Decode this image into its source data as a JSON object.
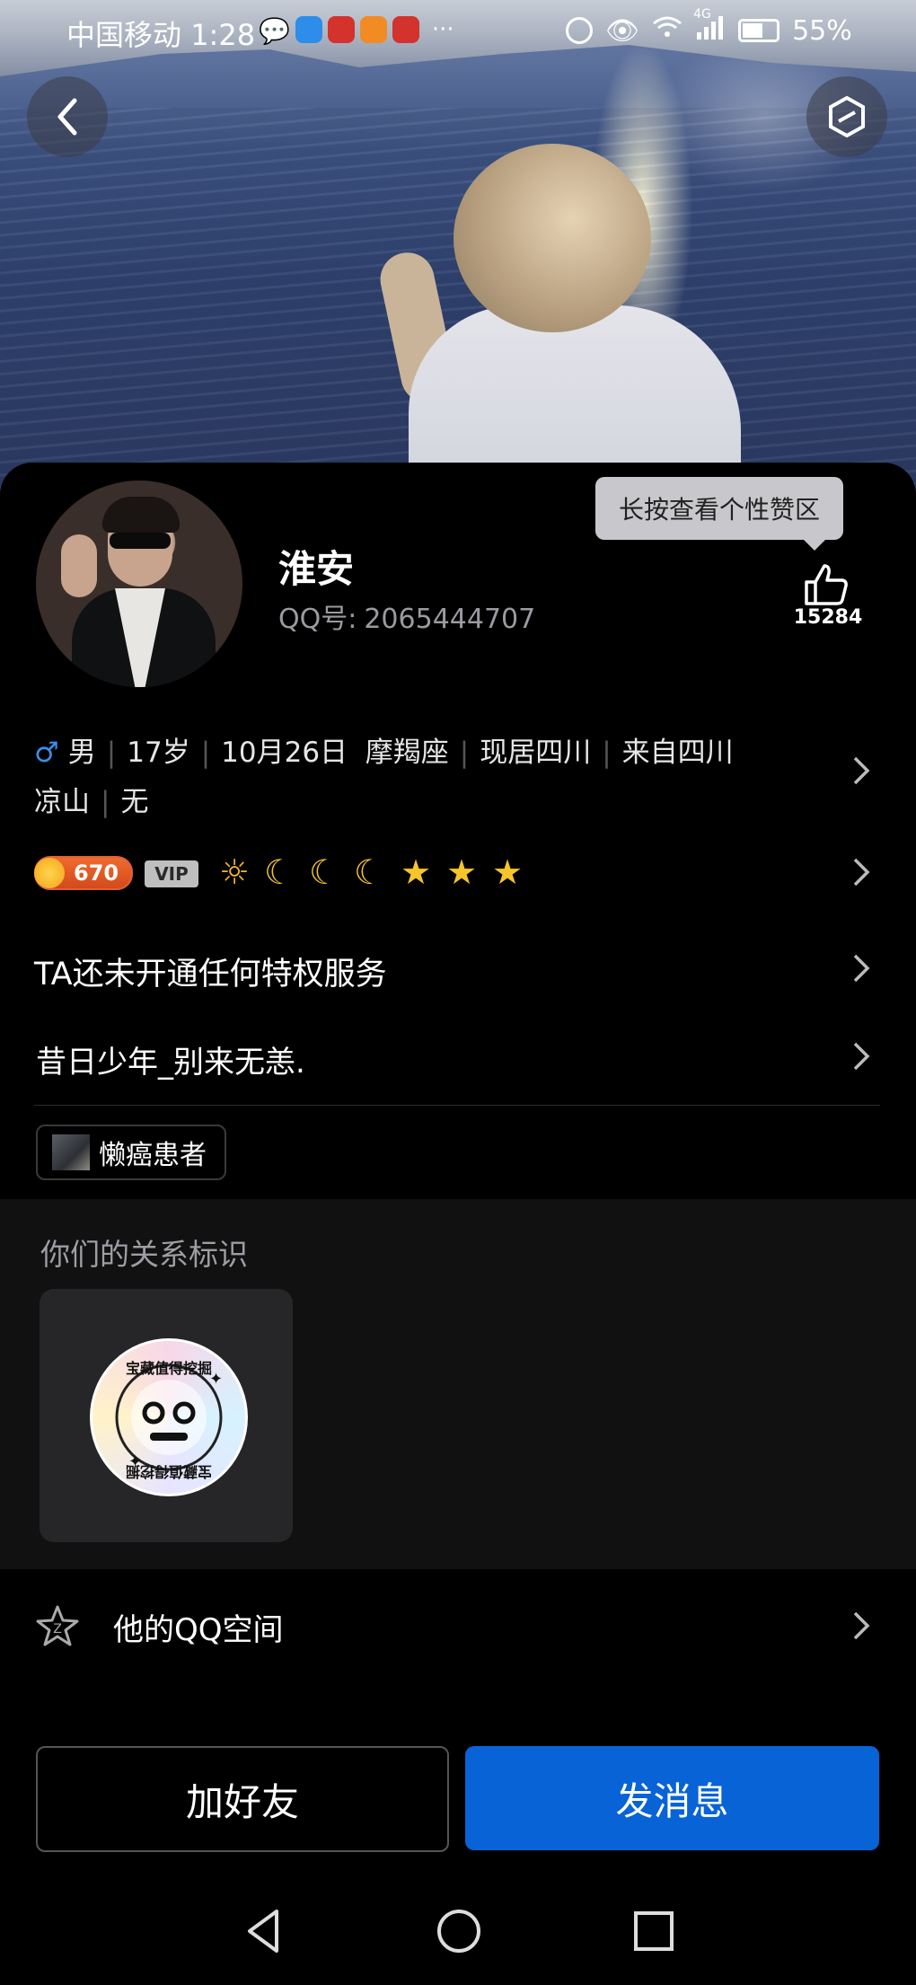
{
  "status_bar": {
    "carrier": "中国移动",
    "time": "1:28",
    "more": "···",
    "network": "4G",
    "battery": "55%"
  },
  "profile": {
    "nickname": "淮安",
    "qq_label": "QQ号:",
    "qq_number": "2065444707",
    "like_tooltip": "长按查看个性赞区",
    "like_count": "15284",
    "gender_icon": "♂",
    "info_line1": [
      "男",
      "17岁",
      "10月26日  摩羯座",
      "现居四川",
      "来自四川"
    ],
    "info_line2": [
      "凉山",
      "无"
    ],
    "level_number": "670",
    "vip_label": "VIP",
    "level_icons": [
      "sun",
      "moon",
      "moon",
      "moon",
      "star",
      "star",
      "star"
    ],
    "privilege_text": "TA还未开通任何特权服务",
    "signature": "昔日少年_别来无恙.",
    "tag_label": "懒癌患者"
  },
  "relation": {
    "title": "你们的关系标识",
    "badge_text": "宝藏值得挖掘"
  },
  "qzone": {
    "label": "他的QQ空间"
  },
  "actions": {
    "add_friend": "加好友",
    "send_message": "发消息"
  },
  "colors": {
    "primary_blue": "#0863d6",
    "background": "#000000",
    "gender_blue": "#3a8ee6",
    "level_orange": "#f06a2e"
  }
}
